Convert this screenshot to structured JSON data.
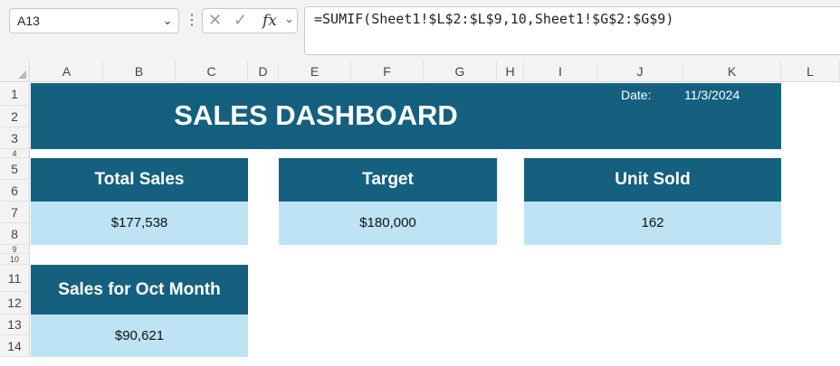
{
  "formula_bar": {
    "name_box": "A13",
    "formula": "=SUMIF(Sheet1!$L$2:$L$9,10,Sheet1!$G$2:$G$9)",
    "fx": "fx",
    "cancel_icon": "close-icon",
    "enter_icon": "checkmark-icon"
  },
  "columns": [
    "A",
    "B",
    "C",
    "D",
    "E",
    "F",
    "G",
    "H",
    "I",
    "J",
    "K",
    "L"
  ],
  "rows": [
    "1",
    "2",
    "3",
    "4",
    "5",
    "6",
    "7",
    "8",
    "9",
    "10",
    "11",
    "12",
    "13",
    "14"
  ],
  "dashboard": {
    "title": "SALES DASHBOARD",
    "date_label": "Date:",
    "date_value": "11/3/2024",
    "header_color": "#15607f",
    "value_color": "#bde3f4",
    "cards": [
      {
        "label": "Total Sales",
        "value": "$177,538"
      },
      {
        "label": "Target",
        "value": "$180,000"
      },
      {
        "label": "Unit Sold",
        "value": "162"
      },
      {
        "label": "Sales for Oct Month",
        "value": "$90,621"
      }
    ]
  }
}
